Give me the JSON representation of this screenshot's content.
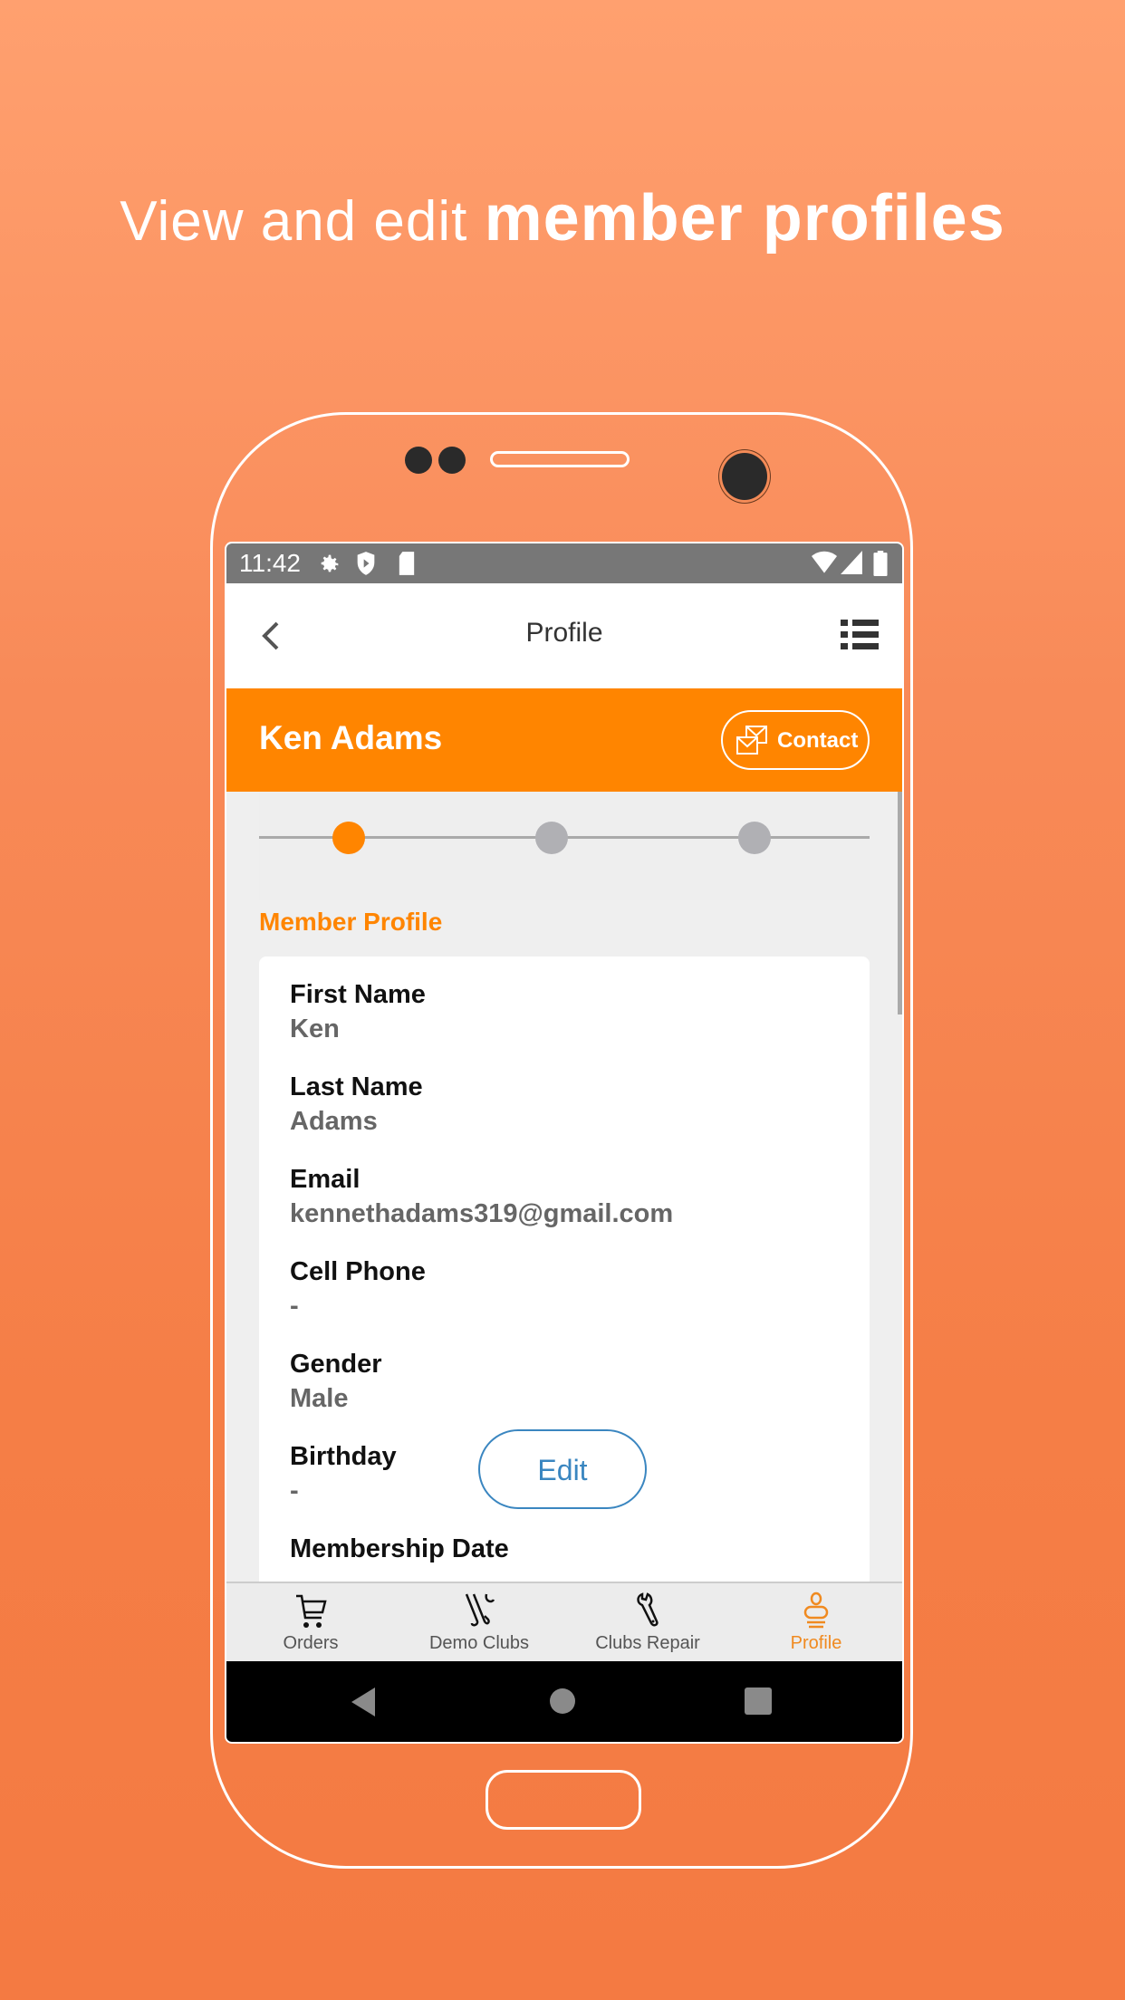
{
  "headline": {
    "light": "View and edit ",
    "bold": "member profiles"
  },
  "status_bar": {
    "time": "11:42",
    "left_icons": [
      "gear-icon",
      "shield-play-icon",
      "sd-card-icon"
    ],
    "right_icons": [
      "wifi-icon",
      "signal-icon",
      "battery-icon"
    ]
  },
  "app_bar": {
    "title": "Profile",
    "back_icon": "chevron-left-icon",
    "menu_icon": "list-icon"
  },
  "member": {
    "name": "Ken Adams",
    "contact_label": "Contact",
    "contact_icon": "envelopes-icon"
  },
  "stepper": {
    "steps": 3,
    "active_step": 1
  },
  "section": {
    "title": "Member Profile"
  },
  "fields": [
    {
      "label": "First Name",
      "value": "Ken"
    },
    {
      "label": "Last Name",
      "value": "Adams"
    },
    {
      "label": "Email",
      "value": "kennethadams319@gmail.com"
    },
    {
      "label": "Cell Phone",
      "value": "-"
    },
    {
      "label": "Gender",
      "value": "Male"
    },
    {
      "label": "Birthday",
      "value": "-"
    },
    {
      "label": "Membership Date",
      "value": ""
    }
  ],
  "edit_label": "Edit",
  "tabs": [
    {
      "label": "Orders",
      "icon": "cart-icon",
      "active": false
    },
    {
      "label": "Demo Clubs",
      "icon": "golf-clubs-icon",
      "active": false
    },
    {
      "label": "Clubs Repair",
      "icon": "wrench-icon",
      "active": false
    },
    {
      "label": "Profile",
      "icon": "person-icon",
      "active": true
    }
  ],
  "nav_buttons": [
    "back-triangle-icon",
    "home-circle-icon",
    "recents-square-icon"
  ],
  "colors": {
    "accent": "#ff8500",
    "link": "#3a86c0",
    "background": "#f88a58"
  }
}
